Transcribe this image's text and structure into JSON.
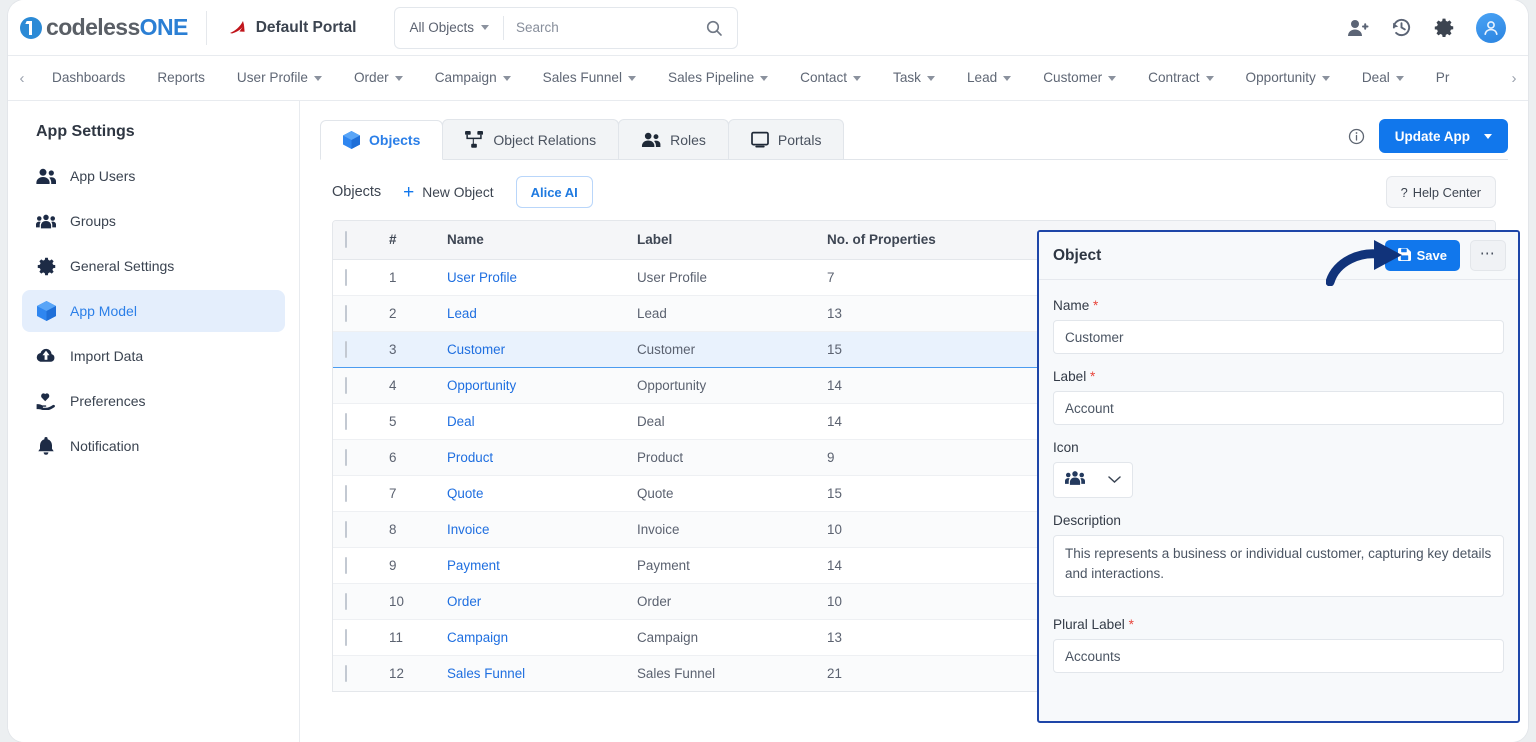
{
  "header": {
    "logo": {
      "part1": "codeless",
      "part2": "ONE",
      "icon": "logo-one-mark"
    },
    "portal": {
      "name": "Default Portal",
      "icon": "portal-triangle-icon"
    },
    "search": {
      "scope": "All Objects",
      "placeholder": "Search",
      "value": "",
      "icon": "search-icon"
    },
    "icons": [
      {
        "name": "add-user-icon"
      },
      {
        "name": "history-icon"
      },
      {
        "name": "gear-icon"
      },
      {
        "name": "avatar-icon"
      }
    ]
  },
  "nav": {
    "prev_icon": "chevron-left-icon",
    "next_icon": "chevron-right-icon",
    "items": [
      {
        "label": "Dashboards",
        "dropdown": false
      },
      {
        "label": "Reports",
        "dropdown": false
      },
      {
        "label": "User Profile",
        "dropdown": true
      },
      {
        "label": "Order",
        "dropdown": true
      },
      {
        "label": "Campaign",
        "dropdown": true
      },
      {
        "label": "Sales Funnel",
        "dropdown": true
      },
      {
        "label": "Sales Pipeline",
        "dropdown": true
      },
      {
        "label": "Contact",
        "dropdown": true
      },
      {
        "label": "Task",
        "dropdown": true
      },
      {
        "label": "Lead",
        "dropdown": true
      },
      {
        "label": "Customer",
        "dropdown": true
      },
      {
        "label": "Contract",
        "dropdown": true
      },
      {
        "label": "Opportunity",
        "dropdown": true
      },
      {
        "label": "Deal",
        "dropdown": true
      },
      {
        "label": "Pr",
        "dropdown": false
      }
    ]
  },
  "sidebar": {
    "title": "App Settings",
    "items": [
      {
        "label": "App Users",
        "icon": "users-icon",
        "active": false
      },
      {
        "label": "Groups",
        "icon": "groups-icon",
        "active": false
      },
      {
        "label": "General Settings",
        "icon": "gear-icon",
        "active": false
      },
      {
        "label": "App Model",
        "icon": "cube-icon",
        "active": true
      },
      {
        "label": "Import Data",
        "icon": "cloud-upload-icon",
        "active": false
      },
      {
        "label": "Preferences",
        "icon": "hand-heart-icon",
        "active": false
      },
      {
        "label": "Notification",
        "icon": "bell-icon",
        "active": false
      }
    ]
  },
  "tabs": {
    "items": [
      {
        "label": "Objects",
        "icon": "cube-icon",
        "active": true
      },
      {
        "label": "Object Relations",
        "icon": "relations-icon",
        "active": false
      },
      {
        "label": "Roles",
        "icon": "users-icon",
        "active": false
      },
      {
        "label": "Portals",
        "icon": "monitor-icon",
        "active": false
      }
    ],
    "info_icon": "info-icon",
    "update_app_label": "Update App"
  },
  "toolbar": {
    "title": "Objects",
    "new_object_label": "New Object",
    "new_object_icon": "plus-icon",
    "alice_ai_label": "Alice AI",
    "help_center_label": "Help Center",
    "help_icon": "question-icon"
  },
  "table": {
    "columns": [
      "#",
      "Name",
      "Label",
      "No. of Properties"
    ],
    "rows": [
      {
        "num": "1",
        "name": "User Profile",
        "label": "User Profile",
        "props": "7",
        "selected": false
      },
      {
        "num": "2",
        "name": "Lead",
        "label": "Lead",
        "props": "13",
        "selected": false
      },
      {
        "num": "3",
        "name": "Customer",
        "label": "Customer",
        "props": "15",
        "selected": true
      },
      {
        "num": "4",
        "name": "Opportunity",
        "label": "Opportunity",
        "props": "14",
        "selected": false
      },
      {
        "num": "5",
        "name": "Deal",
        "label": "Deal",
        "props": "14",
        "selected": false
      },
      {
        "num": "6",
        "name": "Product",
        "label": "Product",
        "props": "9",
        "selected": false
      },
      {
        "num": "7",
        "name": "Quote",
        "label": "Quote",
        "props": "15",
        "selected": false
      },
      {
        "num": "8",
        "name": "Invoice",
        "label": "Invoice",
        "props": "10",
        "selected": false
      },
      {
        "num": "9",
        "name": "Payment",
        "label": "Payment",
        "props": "14",
        "selected": false
      },
      {
        "num": "10",
        "name": "Order",
        "label": "Order",
        "props": "10",
        "selected": false
      },
      {
        "num": "11",
        "name": "Campaign",
        "label": "Campaign",
        "props": "13",
        "selected": false
      },
      {
        "num": "12",
        "name": "Sales Funnel",
        "label": "Sales Funnel",
        "props": "21",
        "selected": false
      }
    ]
  },
  "detail": {
    "title": "Object",
    "save_label": "Save",
    "save_icon": "save-disk-icon",
    "more_icon": "ellipsis-icon",
    "fields": {
      "name_label": "Name",
      "name_value": "Customer",
      "label_label": "Label",
      "label_value": "Account",
      "icon_label": "Icon",
      "icon_value": "groups-icon",
      "description_label": "Description",
      "description_value": "This represents a business or individual customer, capturing key details and interactions.",
      "plural_label": "Plural Label",
      "plural_value": "Accounts"
    }
  },
  "colors": {
    "accent": "#1177ec",
    "link": "#1f6fe0",
    "panel_border": "#1e46a8",
    "required": "#e8443a",
    "selected_row": "#e9f2fd"
  }
}
